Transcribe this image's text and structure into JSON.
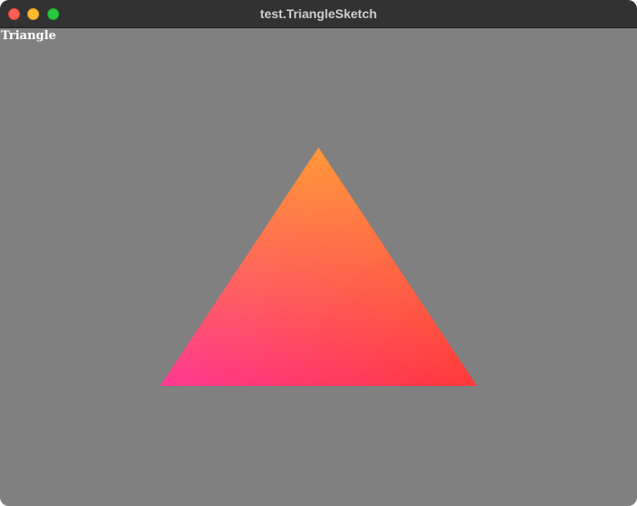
{
  "window": {
    "title": "test.TriangleSketch",
    "controls": [
      "close",
      "minimize",
      "maximize"
    ]
  },
  "canvas": {
    "background": "#808080",
    "label": "Triangle",
    "label_color": "#ffffff",
    "triangle": {
      "colors": {
        "top": "#ff9838",
        "bottom_left": "#ff3894",
        "bottom_right": "#ff3838"
      }
    }
  }
}
